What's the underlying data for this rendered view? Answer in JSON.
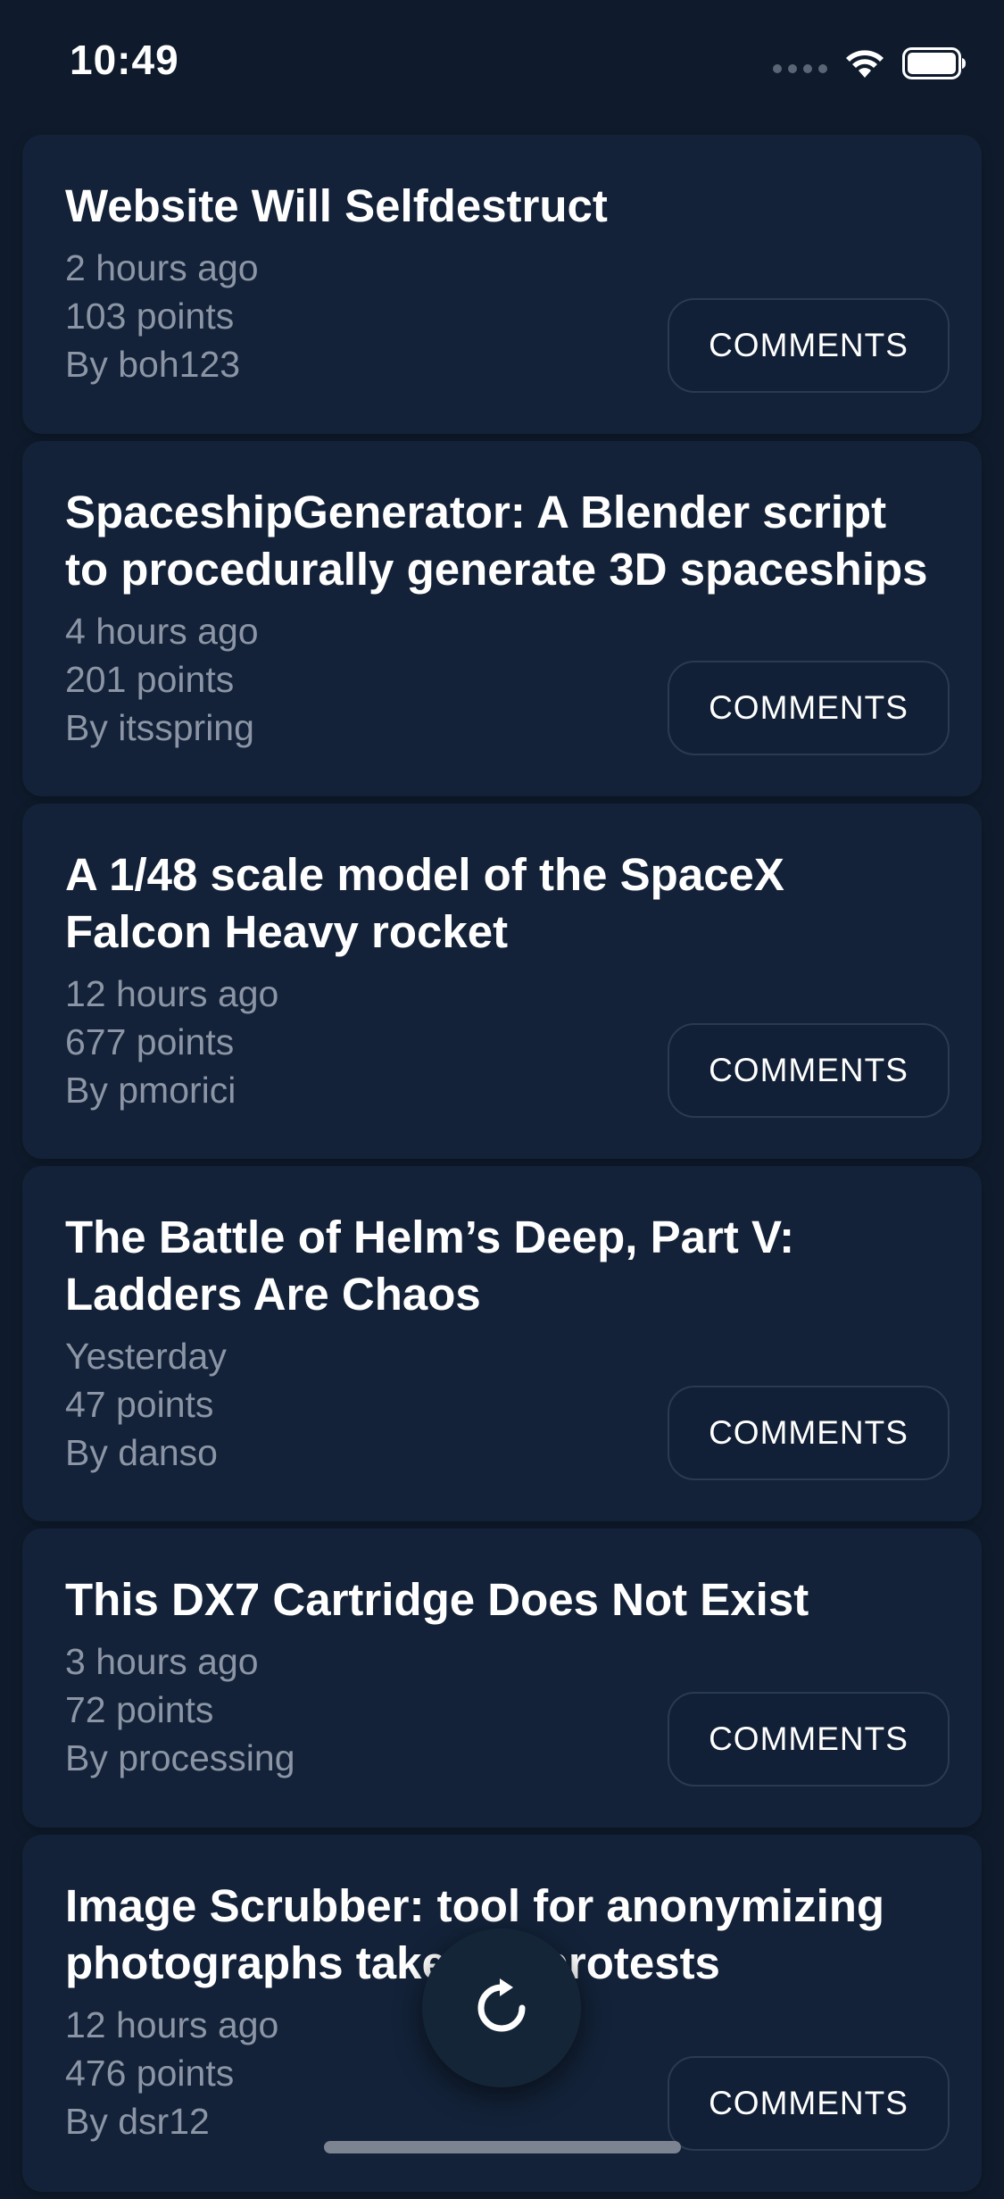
{
  "status_bar": {
    "time": "10:49",
    "icons": [
      "cellular-signal-icon",
      "wifi-icon",
      "battery-icon"
    ]
  },
  "feed": {
    "comments_label": "COMMENTS",
    "items": [
      {
        "title": "Website Will Selfdestruct",
        "time": "2 hours ago",
        "points": "103 points",
        "author": "By boh123"
      },
      {
        "title": "SpaceshipGenerator: A Blender script to procedurally generate 3D spaceships",
        "time": "4 hours ago",
        "points": "201 points",
        "author": "By itsspring"
      },
      {
        "title": "A 1/48 scale model of the SpaceX Falcon Heavy rocket",
        "time": "12 hours ago",
        "points": "677 points",
        "author": "By pmorici"
      },
      {
        "title": "The Battle of Helm’s Deep, Part V: Ladders Are Chaos",
        "time": "Yesterday",
        "points": "47 points",
        "author": "By danso"
      },
      {
        "title": "This DX7 Cartridge Does Not Exist",
        "time": "3 hours ago",
        "points": "72 points",
        "author": "By processing"
      },
      {
        "title": "Image Scrubber: tool for anonymizing photographs taken at protests",
        "time": "12 hours ago",
        "points": "476 points",
        "author": "By dsr12"
      }
    ]
  },
  "fab": {
    "icon": "refresh-icon"
  },
  "colors": {
    "background": "#0f1b2c",
    "card": "#132238",
    "meta_text": "#8b95a5",
    "button_border": "#2a3a52"
  }
}
